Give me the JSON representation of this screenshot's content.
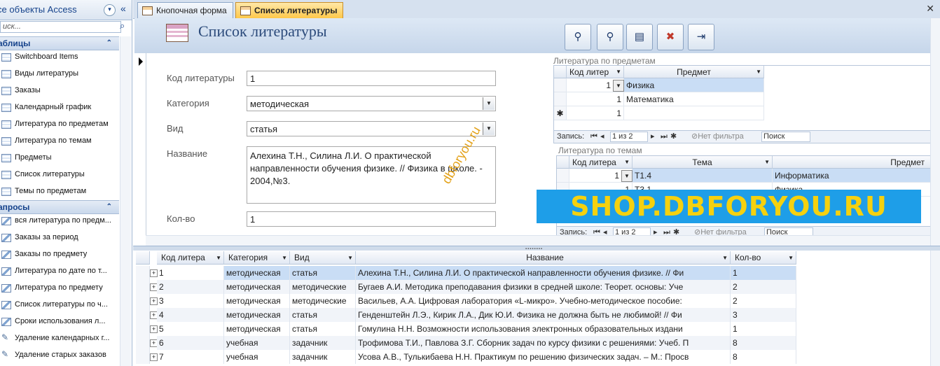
{
  "nav": {
    "title": "се объекты Access",
    "search_placeholder": "иск...",
    "sections": [
      {
        "label": "аблицы",
        "items": [
          "Switchboard Items",
          "Виды литературы",
          "Заказы",
          "Календарный график",
          "Литература по предметам",
          "Литература по темам",
          "Предметы",
          "Список литературы",
          "Темы по предметам"
        ]
      },
      {
        "label": "апросы",
        "items": [
          "вся литература по предм...",
          "Заказы за период",
          "Заказы по предмету",
          "Литература по дате по т...",
          "Литература по предмету",
          "Список литературы по ч...",
          "Сроки использования л...",
          "Удаление календарных г...",
          "Удаление старых заказов"
        ]
      }
    ]
  },
  "tabs": [
    "Кнопочная форма",
    "Список литературы"
  ],
  "form": {
    "title": "Список литературы",
    "fields": {
      "code_label": "Код литературы",
      "code_value": "1",
      "category_label": "Категория",
      "category_value": "методическая",
      "type_label": "Вид",
      "type_value": "статья",
      "name_label": "Название",
      "name_value": "Алехина Т.Н., Силина Л.И. О практической направленности обучения физике. // Физика в школе. - 2004,№3.",
      "qty_label": "Кол-во",
      "qty_value": "1"
    },
    "watermark": "dbforyou.ru",
    "banner": "SHOP.DBFORYOU.RU"
  },
  "sub1": {
    "label": "Литература по предметам",
    "headers": [
      "Код литер",
      "Предмет"
    ],
    "rows": [
      [
        "1",
        "Физика"
      ],
      [
        "1",
        "Математика"
      ],
      [
        "1",
        ""
      ]
    ],
    "nav": {
      "record": "Запись:",
      "pos": "1 из 2",
      "filter": "Нет фильтра",
      "search": "Поиск"
    }
  },
  "sub2": {
    "label": "Литература по темам",
    "headers": [
      "Код литера",
      "Тема",
      "Предмет"
    ],
    "rows": [
      [
        "1",
        "Т1.4",
        "Информатика"
      ],
      [
        "1",
        "Т3.1",
        "Физика"
      ]
    ],
    "nav": {
      "record": "Запись:",
      "pos": "1 из 2",
      "filter": "Нет фильтра",
      "search": "Поиск"
    }
  },
  "datasheet": {
    "headers": [
      "Код литера",
      "Категория",
      "Вид",
      "Название",
      "Кол-во"
    ],
    "rows": [
      [
        "1",
        "методическая",
        "статья",
        "Алехина Т.Н., Силина Л.И. О практической направленности обучения физике. // Фи",
        "1"
      ],
      [
        "2",
        "методическая",
        "методические",
        "Бугаев А.И. Методика преподавания физики в средней школе: Теорет. основы: Уче",
        "2"
      ],
      [
        "3",
        "методическая",
        "методические",
        "Васильев, А.А. Цифровая лаборатория «L-микро». Учебно-методическое пособие:",
        "2"
      ],
      [
        "4",
        "методическая",
        "статья",
        "Генденштейн Л.Э., Кирик Л.А., Дик Ю.И. Физика не должна быть не любимой! // Фи",
        "3"
      ],
      [
        "5",
        "методическая",
        "статья",
        "Гомулина Н.Н. Возможности использования электронных образовательных издани",
        "1"
      ],
      [
        "6",
        "учебная",
        "задачник",
        "Трофимова Т.И., Павлова З.Г. Сборник задач по курсу физики с решениями: Учеб. П",
        "8"
      ],
      [
        "7",
        "учебная",
        "задачник",
        "Усова А.В., Тулькибаева Н.Н. Практикум по решению физических задач. – М.: Просв",
        "8"
      ]
    ]
  }
}
